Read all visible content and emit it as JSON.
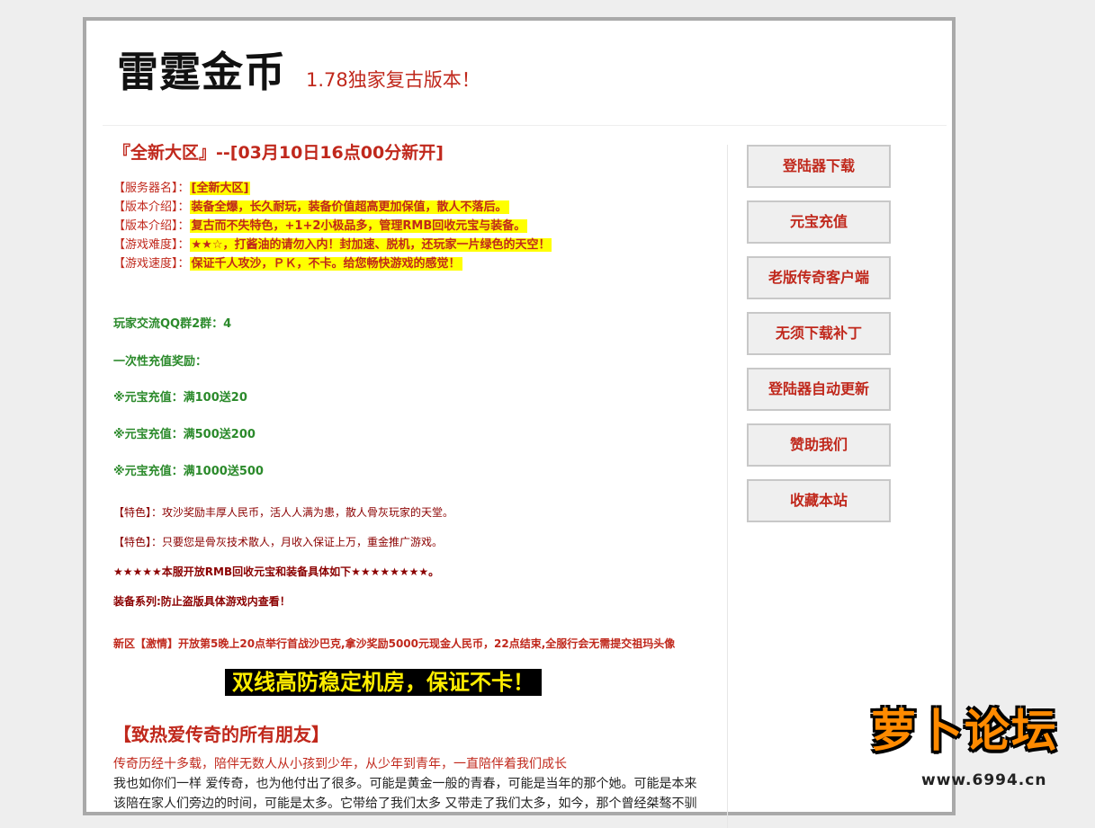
{
  "header": {
    "title": "雷霆金币",
    "subtitle": "1.78独家复古版本！"
  },
  "main": {
    "server_title": "『全新大区』--[03月10日16点00分新开]",
    "info": [
      {
        "label": "【服务器名】：",
        "value": "[全新大区]"
      },
      {
        "label": "【版本介绍】：",
        "value": "装备全爆，长久耐玩，装备价值超高更加保值，散人不落后。"
      },
      {
        "label": "【版本介绍】：",
        "value": "复古而不失特色，+1+2小极品多，管理RMB回收元宝与装备。"
      },
      {
        "label": "【游戏难度】：",
        "value": "★★☆，打酱油的请勿入内！封加速、脱机，还玩家一片绿色的天空！"
      },
      {
        "label": "【游戏速度】：",
        "value": "保证千人攻沙，ＰＫ，不卡。给您畅快游戏的感觉！"
      }
    ],
    "qq_group": "玩家交流QQ群2群：4",
    "recharge_title": "一次性充值奖励：",
    "recharge_items": [
      "※元宝充值：满100送20",
      "※元宝充值：满500送200",
      "※元宝充值：满1000送500"
    ],
    "feature_1": "【特色】：攻沙奖励丰厚人民币，活人人满为患，散人骨灰玩家的天堂。",
    "feature_2": "【特色】：只要您是骨灰技术散人，月收入保证上万，重金推广游戏。",
    "rmb_note": "★★★★★本服开放RMB回收元宝和装备具体如下★★★★★★★★。",
    "equip_note": "装备系列:防止盗版具体游戏内查看！",
    "news": "新区【激情】开放第5晚上20点举行首战沙巴克,拿沙奖励5000元现金人民币，22点结束,全服行会无需提交祖玛头像",
    "banner": "双线高防稳定机房，保证不卡！",
    "friends_title": "【致热爱传奇的所有朋友】",
    "para_red": "传奇历经十多载，陪伴无数人从小孩到少年，从少年到青年，一直陪伴着我们成长",
    "para_black": "我也如你们一样 爱传奇，也为他付出了很多。可能是黄金一般的青春，可能是当年的那个她。可能是本来该陪在家人们旁边的时间，可能是太多。它带给了我们太多 又带走了我们太多，如今，那个曾经桀骜不驯"
  },
  "sidebar": {
    "buttons": [
      "登陆器下载",
      "元宝充值",
      "老版传奇客户端",
      "无须下载补丁",
      "登陆器自动更新",
      "赞助我们",
      "收藏本站"
    ]
  },
  "watermark": {
    "text": "萝卜论坛",
    "url": "www.6994.cn"
  },
  "colors": {
    "accent": "#c0281c",
    "highlight": "#ffff00",
    "green": "#2b8a2b"
  }
}
